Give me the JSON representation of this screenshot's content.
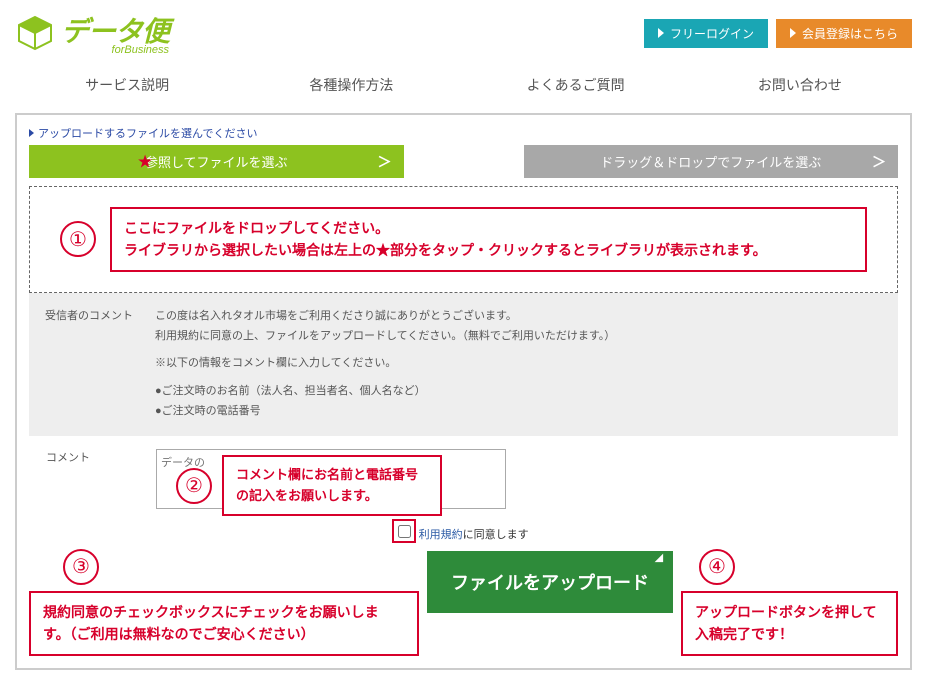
{
  "header": {
    "logo_main": "データ便",
    "logo_sub": "forBusiness",
    "login_btn": "フリーログイン",
    "register_btn": "会員登録はこちら"
  },
  "nav": {
    "items": [
      "サービス説明",
      "各種操作方法",
      "よくあるご質問",
      "お問い合わせ"
    ]
  },
  "main": {
    "prompt": "アップロードするファイルを選んでください",
    "tab_browse": "参照してファイルを選ぶ",
    "tab_dragdrop": "ドラッグ＆ドロップでファイルを選ぶ",
    "drop_anno_num": "①",
    "drop_anno_line1": "ここにファイルをドロップしてください。",
    "drop_anno_line2": "ライブラリから選択したい場合は左上の★部分をタップ・クリックするとライブラリが表示されます。",
    "recv_label": "受信者のコメント",
    "recv_l1": "この度は名入れタオル市場をご利用くださり誠にありがとうございます。",
    "recv_l2": "利用規約に同意の上、ファイルをアップロードしてください。（無料でご利用いただけます。）",
    "recv_l3": "※以下の情報をコメント欄に入力してください。",
    "recv_l4": "●ご注文時のお名前（法人名、担当者名、個人名など）",
    "recv_l5": "●ご注文時の電話番号",
    "comment_label": "コメント",
    "comment_placeholder": "データの",
    "anno2_num": "②",
    "anno2_text": "コメント欄にお名前と電話番号の記入をお願いします。",
    "agree_link": "利用規約",
    "agree_rest": "に同意します",
    "anno3_num": "③",
    "anno3_text": "規約同意のチェックボックスにチェックをお願いします。（ご利用は無料なのでご安心ください）",
    "upload_label": "ファイルをアップロード",
    "anno4_num": "④",
    "anno4_text": "アップロードボタンを押して入稿完了です！",
    "star": "★",
    "arrow": "＞"
  }
}
